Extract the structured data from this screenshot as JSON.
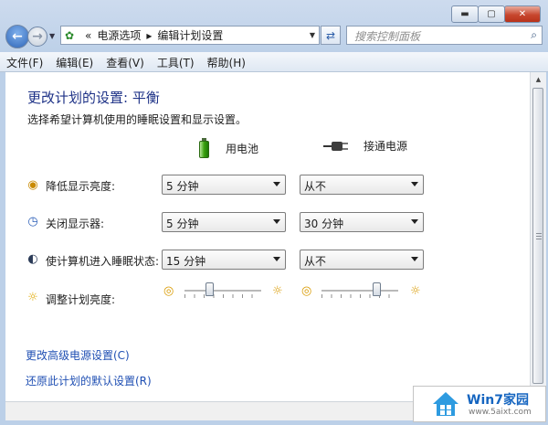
{
  "window": {
    "caption_buttons": [
      "minimize-icon",
      "maximize-icon",
      "close-icon"
    ]
  },
  "nav": {
    "address_chevrons": "«",
    "breadcrumb": [
      "电源选项",
      "编辑计划设置"
    ],
    "breadcrumb_separator": "▸",
    "search_placeholder": "搜索控制面板"
  },
  "menu": [
    "文件(F)",
    "编辑(E)",
    "查看(V)",
    "工具(T)",
    "帮助(H)"
  ],
  "main": {
    "title": "更改计划的设置: 平衡",
    "description": "选择希望计算机使用的睡眠设置和显示设置。",
    "columns": {
      "battery": "用电池",
      "plugged_in": "接通电源"
    },
    "settings": [
      {
        "label": "降低显示亮度:",
        "icon": "dim-brightness-icon",
        "battery": "5 分钟",
        "plugged": "从不"
      },
      {
        "label": "关闭显示器:",
        "icon": "display-clock-icon",
        "battery": "5 分钟",
        "plugged": "30 分钟"
      },
      {
        "label": "使计算机进入睡眠状态:",
        "icon": "sleep-moon-icon",
        "battery": "15 分钟",
        "plugged": "从不"
      }
    ],
    "brightness": {
      "label": "调整计划亮度:",
      "battery_level": 0.3,
      "plugged_level": 0.75
    },
    "links": [
      "更改高级电源设置(C)",
      "还原此计划的默认设置(R)"
    ]
  },
  "watermark": {
    "brand": "Win7家园",
    "url": "www.5aixt.com"
  },
  "colors": {
    "title_blue": "#1e3287",
    "link_blue": "#1f4fb3",
    "battery_green": "#3aa10f",
    "close_red": "#c7472e"
  }
}
